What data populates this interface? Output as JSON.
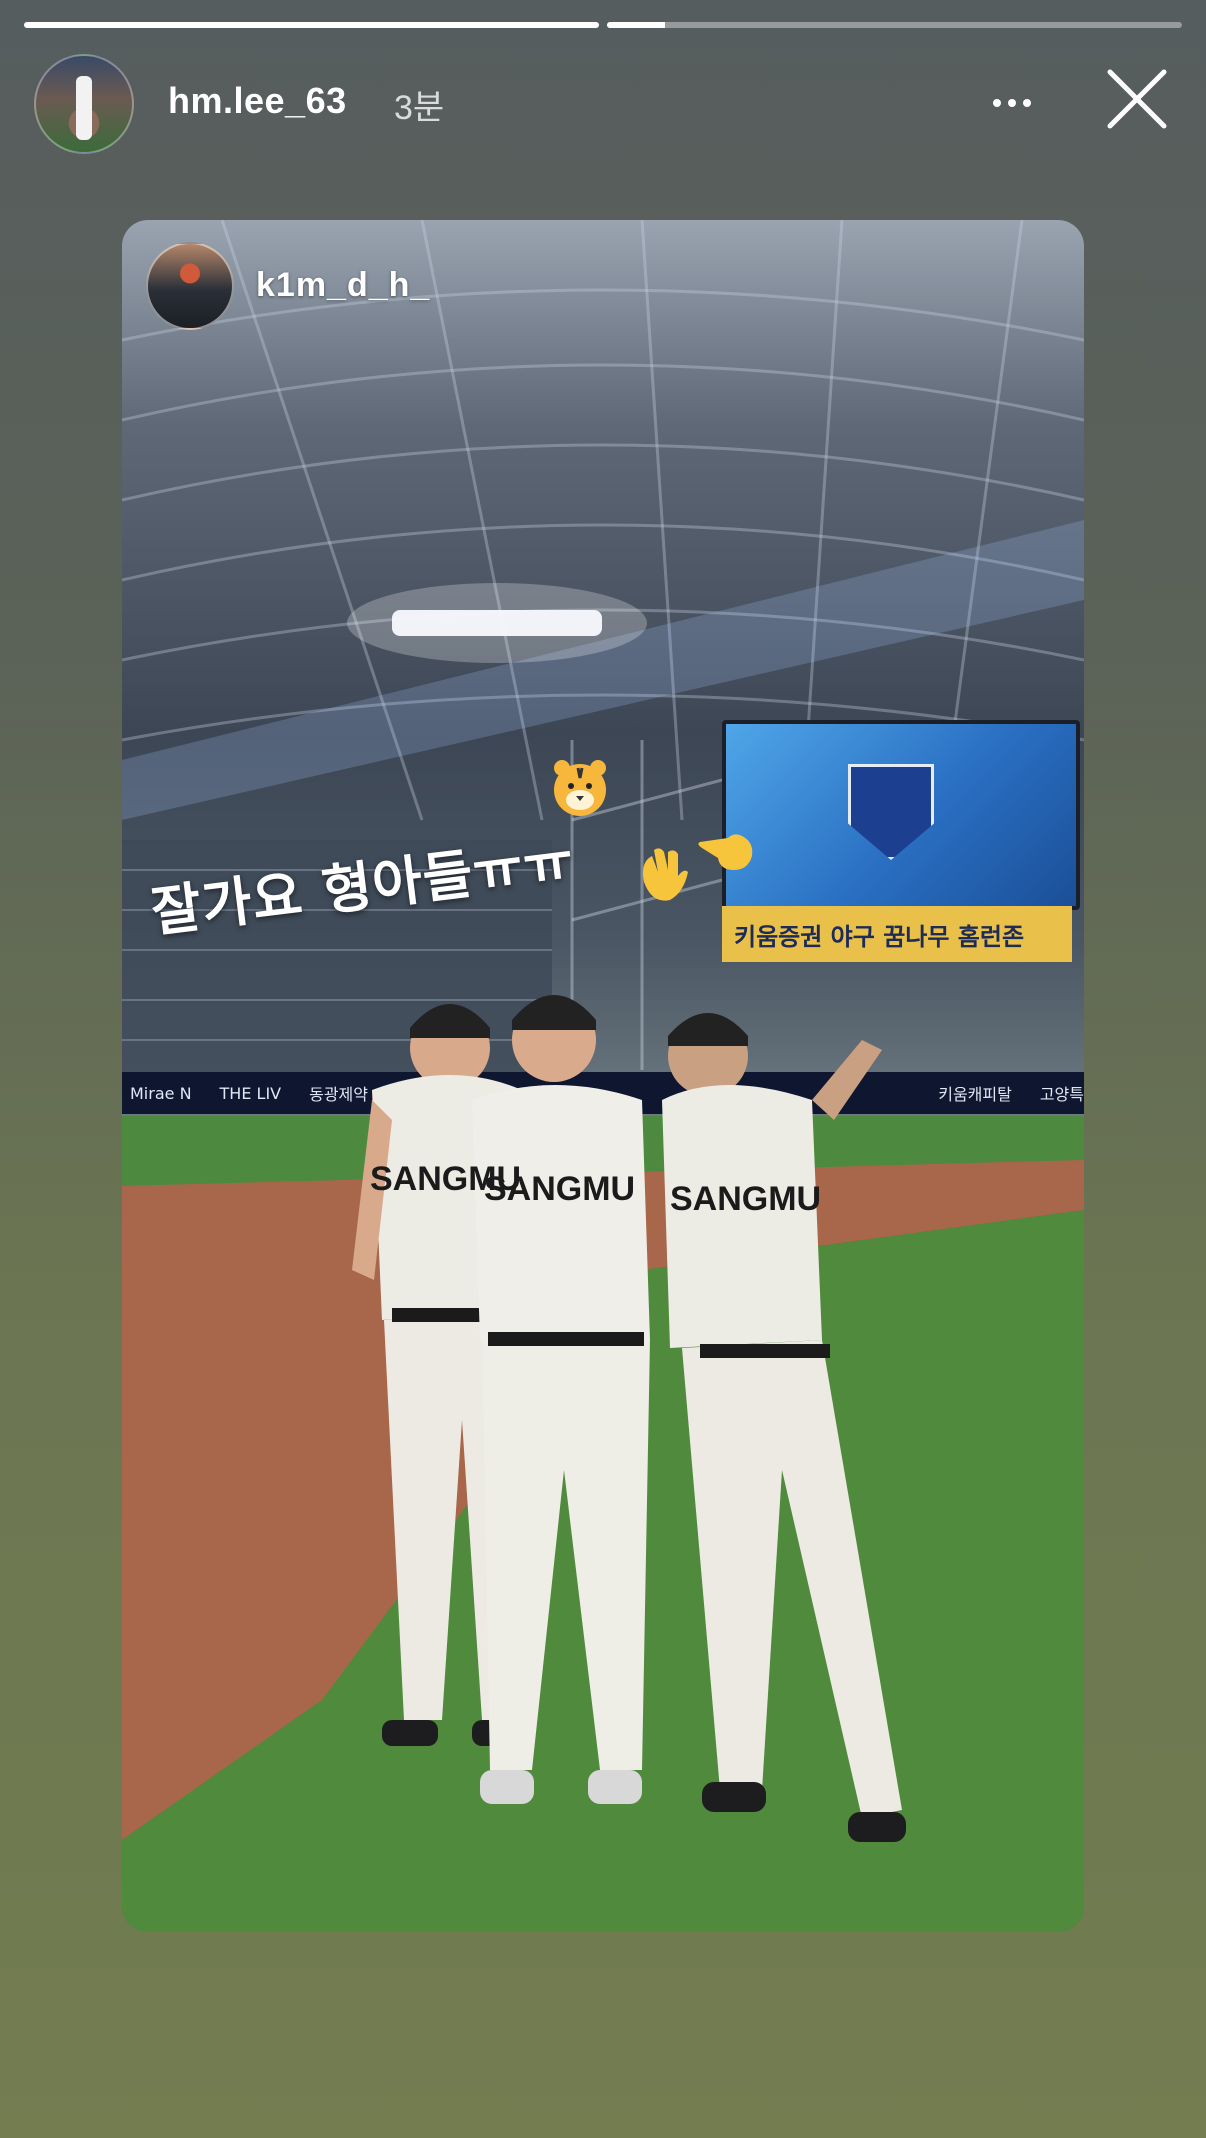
{
  "story": {
    "progress": [
      1.0,
      0.1
    ],
    "author": {
      "username": "hm.lee_63",
      "time": "3분"
    },
    "menu_icon": "more-horizontal-icon",
    "close_icon": "close-icon"
  },
  "shared_post": {
    "username": "k1m_d_h_",
    "caption": "잘가요 형아들ㅠㅠ",
    "stickers": [
      "tiger-emoji",
      "waving-hand-emoji",
      "pointing-hand-emoji"
    ],
    "scoreboard_banner": "키움증권 야구 꿈나무 홈런존",
    "adboard": [
      "Mirae N",
      "THE LIV",
      "동광제약",
      "키움캐피탈",
      "고양특"
    ],
    "jersey_text": [
      "SANGMU",
      "SANGMU",
      "SANGMU"
    ]
  }
}
